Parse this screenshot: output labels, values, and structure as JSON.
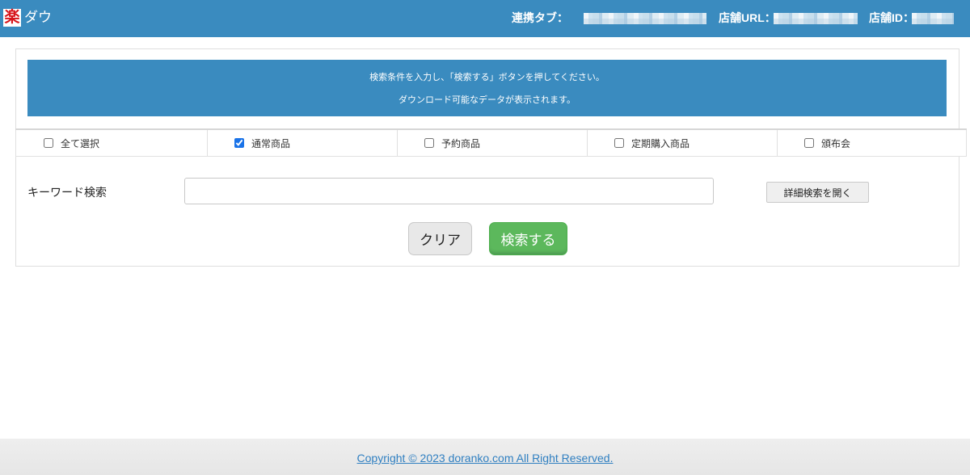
{
  "header": {
    "logo_glyph": "楽",
    "app_name": "ダウ",
    "fields": [
      {
        "label": "連携タブ："
      },
      {
        "label": "店舗URL："
      },
      {
        "label": "店舗ID："
      }
    ]
  },
  "info": {
    "line1": "検索条件を入力し、「検索する」ボタンを押してください。",
    "line2": "ダウンロード可能なデータが表示されます。"
  },
  "filters": [
    {
      "label": "全て選択",
      "checked": false
    },
    {
      "label": "通常商品",
      "checked": true
    },
    {
      "label": "予約商品",
      "checked": false
    },
    {
      "label": "定期購入商品",
      "checked": false
    },
    {
      "label": "頒布会",
      "checked": false
    }
  ],
  "search": {
    "keyword_label": "キーワード検索",
    "keyword_value": "",
    "advanced_button": "詳細検索を開く"
  },
  "actions": {
    "clear_label": "クリア",
    "search_label": "検索する"
  },
  "footer": {
    "copyright": "Copyright © 2023 doranko.com All Right Reserved."
  },
  "colors": {
    "header_bg": "#3a8bbf",
    "banner_bg": "#3a8bbf",
    "logo_red": "#d7141a",
    "search_button_bg": "#5cb85c",
    "link": "#2f7fc1",
    "checkbox_accent": "#1a73e8"
  }
}
